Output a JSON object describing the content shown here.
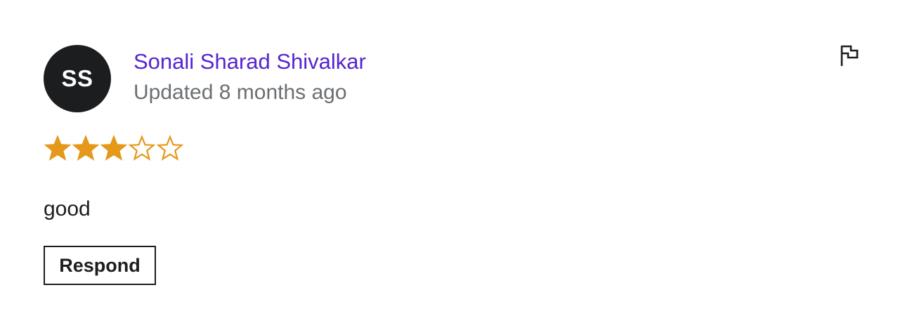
{
  "review": {
    "avatar_initials": "SS",
    "author_name": "Sonali Sharad Shivalkar",
    "updated": "Updated 8 months ago",
    "rating": 3,
    "max_rating": 5,
    "text": "good",
    "respond_label": "Respond",
    "flag_icon": "flag-icon"
  },
  "colors": {
    "author_link": "#5624d0",
    "meta_text": "#6a6f73",
    "star": "#e59819",
    "avatar_bg": "#1c1d1f",
    "text": "#1c1d1f"
  }
}
